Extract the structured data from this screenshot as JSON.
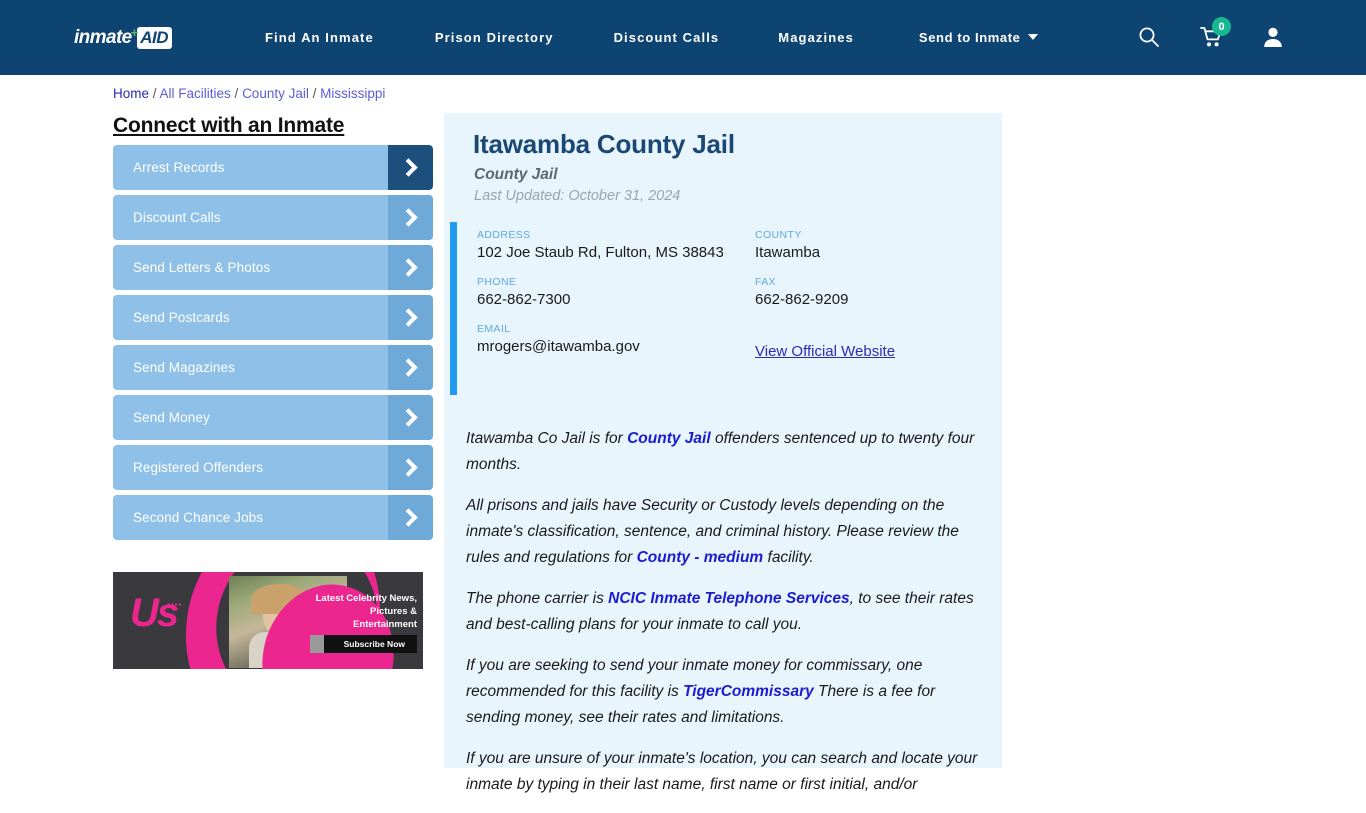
{
  "header": {
    "logo": {
      "text": "inmate",
      "plus": "+",
      "badge": "AID"
    },
    "nav": [
      {
        "label": "Find An Inmate",
        "has_caret": false
      },
      {
        "label": "Prison Directory",
        "has_caret": false
      },
      {
        "label": "Discount Calls",
        "has_caret": false
      },
      {
        "label": "Magazines",
        "has_caret": false
      },
      {
        "label": "Send to Inmate",
        "has_caret": true
      }
    ],
    "icons": {
      "search": "search-icon",
      "cart": "shopping-cart-icon",
      "cart_count": "0",
      "account": "user-account-icon"
    },
    "colors": {
      "background": "#0e4471",
      "badge": "#17b890"
    }
  },
  "breadcrumb": {
    "items": [
      "Home",
      "All Facilities",
      "County Jail",
      "Mississippi"
    ],
    "separator": "/"
  },
  "sidebar": {
    "title": "Connect with an Inmate",
    "items": [
      {
        "label": "Arrest Records",
        "active": true
      },
      {
        "label": "Discount Calls",
        "active": false
      },
      {
        "label": "Send Letters & Photos",
        "active": false
      },
      {
        "label": "Send Postcards",
        "active": false
      },
      {
        "label": "Send Magazines",
        "active": false
      },
      {
        "label": "Send Money",
        "active": false
      },
      {
        "label": "Registered Offenders",
        "active": false
      },
      {
        "label": "Second Chance Jobs",
        "active": false
      }
    ],
    "ad": {
      "brand": "Us",
      "headline": "Latest Celebrity News, Pictures & Entertainment",
      "cta": "Subscribe Now"
    }
  },
  "facility": {
    "name": "Itawamba County Jail",
    "type": "County Jail",
    "last_updated": "Last Updated: October 31, 2024",
    "fields": {
      "address_label": "ADDRESS",
      "address_value": "102 Joe Staub Rd, Fulton, MS 38843",
      "county_label": "COUNTY",
      "county_value": "Itawamba",
      "phone_label": "PHONE",
      "phone_value": "662-862-7300",
      "fax_label": "FAX",
      "fax_value": "662-862-9209",
      "email_label": "EMAIL",
      "email_value": "mrogers@itawamba.gov",
      "website_link": "View Official Website"
    },
    "paragraphs": [
      {
        "parts": [
          {
            "t": "Itawamba Co Jail is for ",
            "b": false
          },
          {
            "t": "County Jail",
            "b": true
          },
          {
            "t": " offenders sentenced up to twenty four months.",
            "b": false
          }
        ]
      },
      {
        "parts": [
          {
            "t": "All prisons and jails have Security or Custody levels depending on the inmate's classification, sentence, and criminal history. Please review the rules and regulations for ",
            "b": false
          },
          {
            "t": "County - medium",
            "b": true
          },
          {
            "t": " facility.",
            "b": false
          }
        ]
      },
      {
        "parts": [
          {
            "t": "The phone carrier is ",
            "b": false
          },
          {
            "t": "NCIC Inmate Telephone Services",
            "b": true
          },
          {
            "t": ", to see their rates and best-calling plans for your inmate to call you.",
            "b": false
          }
        ]
      },
      {
        "parts": [
          {
            "t": "If you are seeking to send your inmate money for commissary, one recommended for this facility is ",
            "b": false
          },
          {
            "t": "TigerCommissary",
            "b": true
          },
          {
            "t": " There is a fee for sending money, see their rates and limitations.",
            "b": false
          }
        ]
      },
      {
        "parts": [
          {
            "t": "If you are unsure of your inmate's location, you can search and locate your inmate by typing in their last name, first name or first initial, and/or",
            "b": false
          }
        ]
      }
    ],
    "colors": {
      "panel_bg": "#e9f5fd",
      "accent": "#1f9af0",
      "title": "#1b4775",
      "link": "#1b1bd0"
    }
  }
}
